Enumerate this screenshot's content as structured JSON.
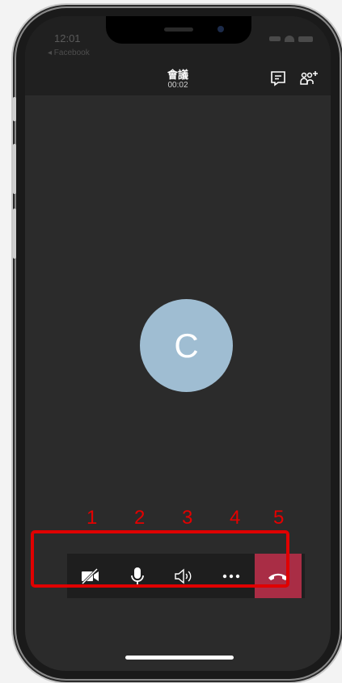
{
  "status_bar": {
    "time": "12:01",
    "back_label": "◂ Facebook"
  },
  "call": {
    "title": "會議",
    "timer": "00:02"
  },
  "avatar": {
    "initial": "C",
    "color": "#9fbdd2"
  },
  "toolbar": {
    "buttons": [
      {
        "name": "camera-off-button",
        "icon": "video-off-icon"
      },
      {
        "name": "mic-button",
        "icon": "microphone-icon"
      },
      {
        "name": "speaker-button",
        "icon": "speaker-icon"
      },
      {
        "name": "more-options-button",
        "icon": "more-icon"
      },
      {
        "name": "hang-up-button",
        "icon": "phone-hangup-icon",
        "color": "#a92d45"
      }
    ]
  },
  "annotations": {
    "labels": [
      "1",
      "2",
      "3",
      "4",
      "5"
    ],
    "color": "#e00000"
  }
}
